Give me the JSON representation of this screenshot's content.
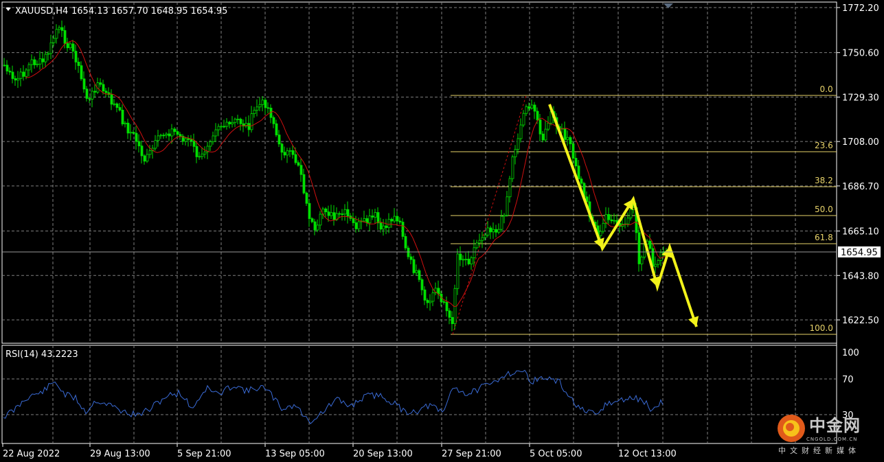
{
  "header": {
    "symbol": "XAUUSD,H4",
    "ohlc": "1654.13 1657.70 1648.95 1654.95",
    "menu_icon": "triangle-down-icon"
  },
  "price_axis": {
    "labels": [
      "1772.20",
      "1750.60",
      "1729.30",
      "1708.00",
      "1686.70",
      "1665.10",
      "1643.80",
      "1622.50"
    ],
    "current_price": "1654.95"
  },
  "fibonacci": {
    "levels": [
      "0.0",
      "23.6",
      "38.2",
      "50.0",
      "61.8",
      "100.0"
    ],
    "color": "#e8d36a"
  },
  "indicator": {
    "label": "RSI(14) 43.2223",
    "axis_labels": [
      "100",
      "70",
      "30"
    ],
    "color": "#3a6bd6"
  },
  "time_axis": {
    "labels": [
      "22 Aug 2022",
      "29 Aug 13:00",
      "5 Sep 21:00",
      "13 Sep 05:00",
      "20 Sep 13:00",
      "27 Sep 21:00",
      "5 Oct 05:00",
      "12 Oct 13:00"
    ]
  },
  "colors": {
    "background": "#000000",
    "candles": "#00e000",
    "ma_line": "#d01010",
    "arrows": "#f2f21a",
    "grid": "#7f7f7f",
    "axis_text": "#ffffff"
  },
  "watermark": {
    "brand": "中金网",
    "site": "CNGOLD.COM.CN",
    "tagline": "中文财经新媒体"
  }
}
